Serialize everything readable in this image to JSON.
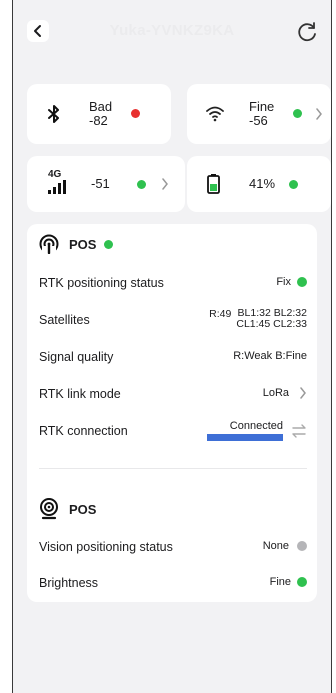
{
  "header": {
    "title": "Yuka-YVNKZ9KA"
  },
  "tiles": {
    "bluetooth": {
      "status": "Bad",
      "value": "-82",
      "dot_color": "#e8302f"
    },
    "wifi": {
      "status": "Fine",
      "value": "-56",
      "dot_color": "#2fc14f"
    },
    "cellular": {
      "badge": "4G",
      "value": "-51",
      "dot_color": "#2fc14f"
    },
    "battery": {
      "value": "41%",
      "dot_color": "#2fc14f",
      "level": 0.41
    }
  },
  "rtk": {
    "title": "POS",
    "rows": [
      {
        "key": "RTK positioning status",
        "value": "Fix"
      },
      {
        "key": "Satellites",
        "prefix": "R:49",
        "line1": "BL1:32 BL2:32",
        "line2": "CL1:45 CL2:33"
      },
      {
        "key": "Signal quality",
        "value": "R:Weak B:Fine"
      },
      {
        "key": "RTK link mode",
        "value": "LoRa"
      },
      {
        "key": "RTK connection",
        "value": "Connected"
      }
    ]
  },
  "vision": {
    "title": "POS",
    "rows": [
      {
        "key": "Vision positioning status",
        "value": "None"
      },
      {
        "key": "Brightness",
        "value": "Fine"
      }
    ]
  }
}
